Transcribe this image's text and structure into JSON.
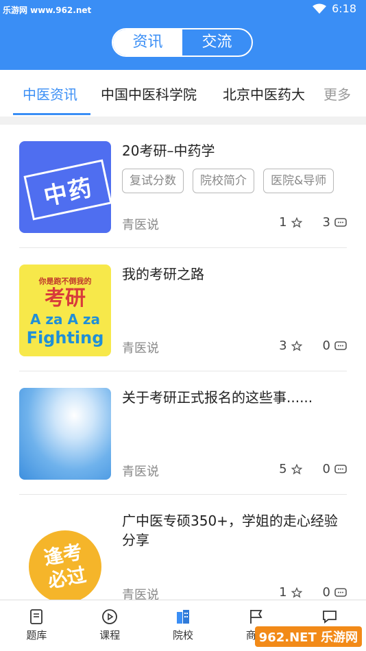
{
  "status_bar": {
    "watermark": "乐游网 www.962.net",
    "time": "6:18"
  },
  "segment": {
    "left": "资讯",
    "right": "交流"
  },
  "tabs": [
    "中医资讯",
    "中国中医科学院",
    "北京中医药大",
    "更多"
  ],
  "items": [
    {
      "title": "20考研–中药学",
      "tags": [
        "复试分数",
        "院校简介",
        "医院&导师"
      ],
      "author": "青医说",
      "stars": "1",
      "comments": "3",
      "thumb_text": "中药"
    },
    {
      "title": "我的考研之路",
      "tags": [],
      "author": "青医说",
      "stars": "3",
      "comments": "0",
      "thumb_lines": [
        "你是跑不倒我的",
        "考研",
        "A za A za",
        "Fighting"
      ]
    },
    {
      "title": "关于考研正式报名的这些事......",
      "tags": [],
      "author": "青医说",
      "stars": "5",
      "comments": "0"
    },
    {
      "title": "广中医专硕350+，学姐的走心经验分享",
      "tags": [],
      "author": "青医说",
      "stars": "1",
      "comments": "0",
      "thumb_text": "逢考必过"
    }
  ],
  "bottom_nav": [
    {
      "label": "题库",
      "icon": "doc-icon"
    },
    {
      "label": "课程",
      "icon": "play-icon"
    },
    {
      "label": "院校",
      "icon": "building-icon"
    },
    {
      "label": "商城",
      "icon": "flag-icon"
    },
    {
      "label": "",
      "icon": "chat-icon"
    }
  ],
  "watermark_bottom": "962.NET 乐游网",
  "colors": {
    "primary": "#3a8ef5",
    "thumb1_bg": "#4f6ef0",
    "thumb2_bg": "#f7e84a"
  }
}
